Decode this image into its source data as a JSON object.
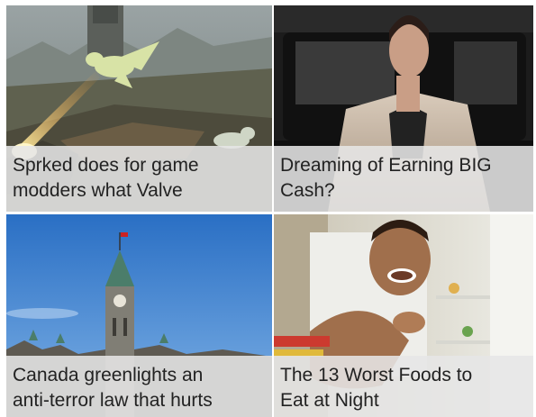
{
  "cards": [
    {
      "line1": "Sprked does for game",
      "line2": "modders what Valve"
    },
    {
      "line1": "Dreaming of Earning BIG",
      "line2": "Cash?"
    },
    {
      "line1": "Canada greenlights an",
      "line2": "anti-terror law that hurts"
    },
    {
      "line1": "The 13 Worst Foods to",
      "line2": "Eat at Night"
    }
  ]
}
